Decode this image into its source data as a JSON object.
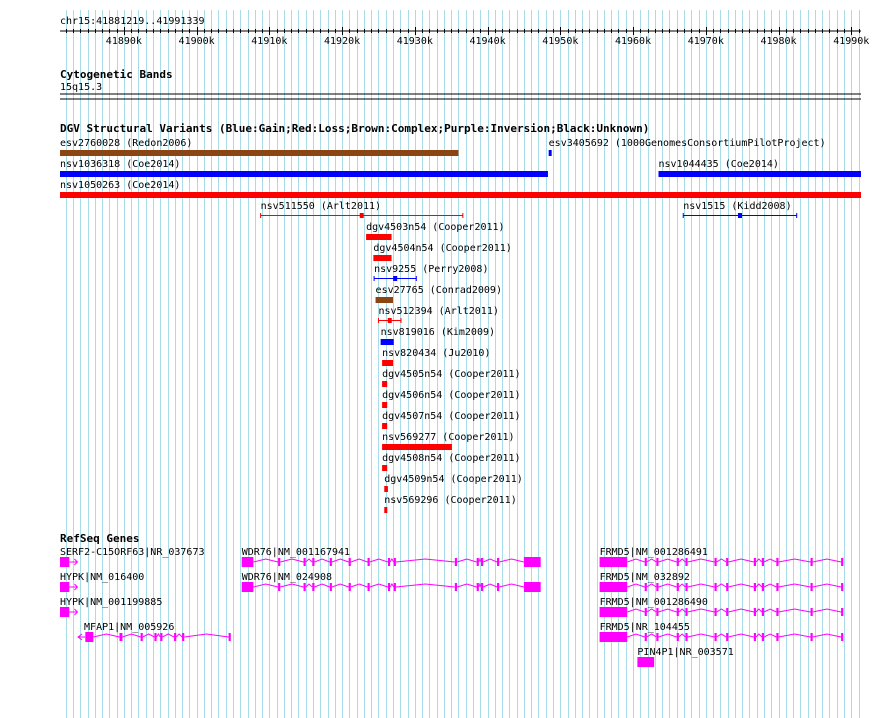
{
  "region": "chr15:41881219..41991339",
  "ruler": {
    "start": 41881219,
    "end": 41991339,
    "ticks": [
      "41890k",
      "41900k",
      "41910k",
      "41920k",
      "41930k",
      "41940k",
      "41950k",
      "41960k",
      "41970k",
      "41980k",
      "41990k"
    ]
  },
  "tracks": {
    "cytoband": {
      "title": "Cytogenetic Bands",
      "band": "15q15.3"
    },
    "dgv": {
      "title": "DGV Structural Variants (Blue:Gain;Red:Loss;Brown:Complex;Purple:Inversion;Black:Unknown)"
    },
    "refseq": {
      "title": "RefSeq Genes"
    }
  },
  "colors": {
    "gain": "#0000ff",
    "loss": "#ff0000",
    "complex": "#8b4513",
    "gene": "#ff00ff",
    "grid": "#a8dce8",
    "background": "#ffffff"
  },
  "variants": [
    {
      "label": "esv2760028 (Redon2006)",
      "start": 41881219,
      "end": 41936000,
      "type": "complex",
      "style": "bar"
    },
    {
      "label": "esv3405692 (1000GenomesConsortiumPilotProject)",
      "start": 41948400,
      "end": 41948700,
      "type": "gain",
      "style": "bar"
    },
    {
      "label": "nsv1036318 (Coe2014)",
      "start": 41881219,
      "end": 41948300,
      "type": "gain",
      "style": "bar"
    },
    {
      "label": "nsv1044435 (Coe2014)",
      "start": 41963500,
      "end": 41991339,
      "type": "gain",
      "style": "bar"
    },
    {
      "label": "nsv1050263 (Coe2014)",
      "start": 41881219,
      "end": 41991339,
      "type": "loss",
      "style": "bar"
    },
    {
      "label": "nsv511550 (Arlt2011)",
      "start": 41908800,
      "end": 41936600,
      "type": "loss",
      "style": "interval"
    },
    {
      "label": "nsv1515 (Kidd2008)",
      "start": 41966900,
      "end": 41982500,
      "type": "gain",
      "style": "interval"
    },
    {
      "label": "dgv4503n54 (Cooper2011)",
      "start": 41923300,
      "end": 41926800,
      "type": "loss",
      "style": "bar"
    },
    {
      "label": "dgv4504n54 (Cooper2011)",
      "start": 41924300,
      "end": 41926800,
      "type": "loss",
      "style": "bar"
    },
    {
      "label": "nsv9255 (Perry2008)",
      "start": 41924400,
      "end": 41930200,
      "type": "gain",
      "style": "interval"
    },
    {
      "label": "esv27765 (Conrad2009)",
      "start": 41924600,
      "end": 41927000,
      "type": "complex",
      "style": "bar"
    },
    {
      "label": "nsv512394 (Arlt2011)",
      "start": 41925000,
      "end": 41928100,
      "type": "loss",
      "style": "interval"
    },
    {
      "label": "nsv819016 (Kim2009)",
      "start": 41925300,
      "end": 41927100,
      "type": "gain",
      "style": "bar"
    },
    {
      "label": "nsv820434 (Ju2010)",
      "start": 41925500,
      "end": 41927000,
      "type": "loss",
      "style": "bar"
    },
    {
      "label": "dgv4505n54 (Cooper2011)",
      "start": 41925500,
      "end": 41926200,
      "type": "loss",
      "style": "bar"
    },
    {
      "label": "dgv4506n54 (Cooper2011)",
      "start": 41925500,
      "end": 41926200,
      "type": "loss",
      "style": "bar"
    },
    {
      "label": "dgv4507n54 (Cooper2011)",
      "start": 41925500,
      "end": 41926200,
      "type": "loss",
      "style": "bar"
    },
    {
      "label": "nsv569277 (Cooper2011)",
      "start": 41925500,
      "end": 41935100,
      "type": "loss",
      "style": "bar"
    },
    {
      "label": "dgv4508n54 (Cooper2011)",
      "start": 41925500,
      "end": 41926200,
      "type": "loss",
      "style": "bar"
    },
    {
      "label": "dgv4509n54 (Cooper2011)",
      "start": 41925800,
      "end": 41926300,
      "type": "loss",
      "style": "bar"
    },
    {
      "label": "nsv569296 (Cooper2011)",
      "start": 41925800,
      "end": 41926200,
      "type": "loss",
      "style": "bar"
    }
  ],
  "genes": [
    {
      "label": "SERF2-C15ORF63|NR_037673",
      "start": 41881219,
      "end": 41883200,
      "strand": "+",
      "exons": [
        [
          41881219,
          41882500
        ]
      ]
    },
    {
      "label": "HYPK|NM_016400",
      "start": 41881219,
      "end": 41883200,
      "strand": "+",
      "exons": [
        [
          41881219,
          41882500
        ]
      ]
    },
    {
      "label": "HYPK|NM_001199885",
      "start": 41881219,
      "end": 41883200,
      "strand": "+",
      "exons": [
        [
          41881219,
          41882500
        ]
      ]
    },
    {
      "label": "MFAP1|NM_005926",
      "start": 41883700,
      "end": 41904700,
      "strand": "-",
      "exons": [
        [
          41884700,
          41885800
        ],
        [
          41889400,
          41889800
        ],
        [
          41892300,
          41892600
        ],
        [
          41894200,
          41894500
        ],
        [
          41895000,
          41895300
        ],
        [
          41896900,
          41897200
        ],
        [
          41898000,
          41898300
        ],
        [
          41904400,
          41904700
        ]
      ]
    },
    {
      "label": "WDR76|NM_001167941",
      "start": 41906200,
      "end": 41947300,
      "strand": "+",
      "exons": [
        [
          41906200,
          41907800
        ],
        [
          41911200,
          41911500
        ],
        [
          41914700,
          41915000
        ],
        [
          41915900,
          41916200
        ],
        [
          41918300,
          41918600
        ],
        [
          41920900,
          41921200
        ],
        [
          41923500,
          41923800
        ],
        [
          41926300,
          41926600
        ],
        [
          41927100,
          41927400
        ],
        [
          41935500,
          41935800
        ],
        [
          41938500,
          41938800
        ],
        [
          41939100,
          41939400
        ],
        [
          41941300,
          41941600
        ],
        [
          41945000,
          41947300
        ]
      ]
    },
    {
      "label": "WDR76|NM_024908",
      "start": 41906200,
      "end": 41947300,
      "strand": "+",
      "exons": [
        [
          41906200,
          41907800
        ],
        [
          41911200,
          41911500
        ],
        [
          41914700,
          41915000
        ],
        [
          41915900,
          41916200
        ],
        [
          41918300,
          41918600
        ],
        [
          41920900,
          41921200
        ],
        [
          41923500,
          41923800
        ],
        [
          41926300,
          41926600
        ],
        [
          41927100,
          41927400
        ],
        [
          41935500,
          41935800
        ],
        [
          41938500,
          41938800
        ],
        [
          41939100,
          41939400
        ],
        [
          41941300,
          41941600
        ],
        [
          41945000,
          41947300
        ]
      ]
    },
    {
      "label": "FRMD5|NM_001286491",
      "start": 41955400,
      "end": 41991339,
      "strand": "+",
      "exons": [
        [
          41955400,
          41959200
        ],
        [
          41961600,
          41961900
        ],
        [
          41963200,
          41963500
        ],
        [
          41966000,
          41966300
        ],
        [
          41967200,
          41967500
        ],
        [
          41971200,
          41971500
        ],
        [
          41972800,
          41973100
        ],
        [
          41976600,
          41976900
        ],
        [
          41977700,
          41978000
        ],
        [
          41979700,
          41980000
        ],
        [
          41984400,
          41984700
        ],
        [
          41988600,
          41988900
        ]
      ]
    },
    {
      "label": "FRMD5|NM_032892",
      "start": 41955400,
      "end": 41991339,
      "strand": "+",
      "exons": [
        [
          41955400,
          41959200
        ],
        [
          41961600,
          41961900
        ],
        [
          41963200,
          41963500
        ],
        [
          41966000,
          41966300
        ],
        [
          41967200,
          41967500
        ],
        [
          41971200,
          41971500
        ],
        [
          41972800,
          41973100
        ],
        [
          41976600,
          41976900
        ],
        [
          41977700,
          41978000
        ],
        [
          41979700,
          41980000
        ],
        [
          41984400,
          41984700
        ],
        [
          41988600,
          41988900
        ]
      ]
    },
    {
      "label": "FRMD5|NM_001286490",
      "start": 41955400,
      "end": 41991339,
      "strand": "+",
      "exons": [
        [
          41955400,
          41959200
        ],
        [
          41961600,
          41961900
        ],
        [
          41963200,
          41963500
        ],
        [
          41966000,
          41966300
        ],
        [
          41967200,
          41967500
        ],
        [
          41971200,
          41971500
        ],
        [
          41972800,
          41973100
        ],
        [
          41976600,
          41976900
        ],
        [
          41977700,
          41978000
        ],
        [
          41979700,
          41980000
        ],
        [
          41984400,
          41984700
        ],
        [
          41988600,
          41988900
        ]
      ]
    },
    {
      "label": "FRMD5|NR_104455",
      "start": 41955400,
      "end": 41991339,
      "strand": "+",
      "exons": [
        [
          41955400,
          41959200
        ],
        [
          41961600,
          41961900
        ],
        [
          41963200,
          41963500
        ],
        [
          41966000,
          41966300
        ],
        [
          41967200,
          41967500
        ],
        [
          41971200,
          41971500
        ],
        [
          41972800,
          41973100
        ],
        [
          41976600,
          41976900
        ],
        [
          41977700,
          41978000
        ],
        [
          41979700,
          41980000
        ],
        [
          41984400,
          41984700
        ],
        [
          41988600,
          41988900
        ]
      ]
    },
    {
      "label": "PIN4P1|NR_003571",
      "start": 41960600,
      "end": 41962900,
      "strand": "",
      "exons": [
        [
          41960600,
          41962900
        ]
      ]
    }
  ]
}
